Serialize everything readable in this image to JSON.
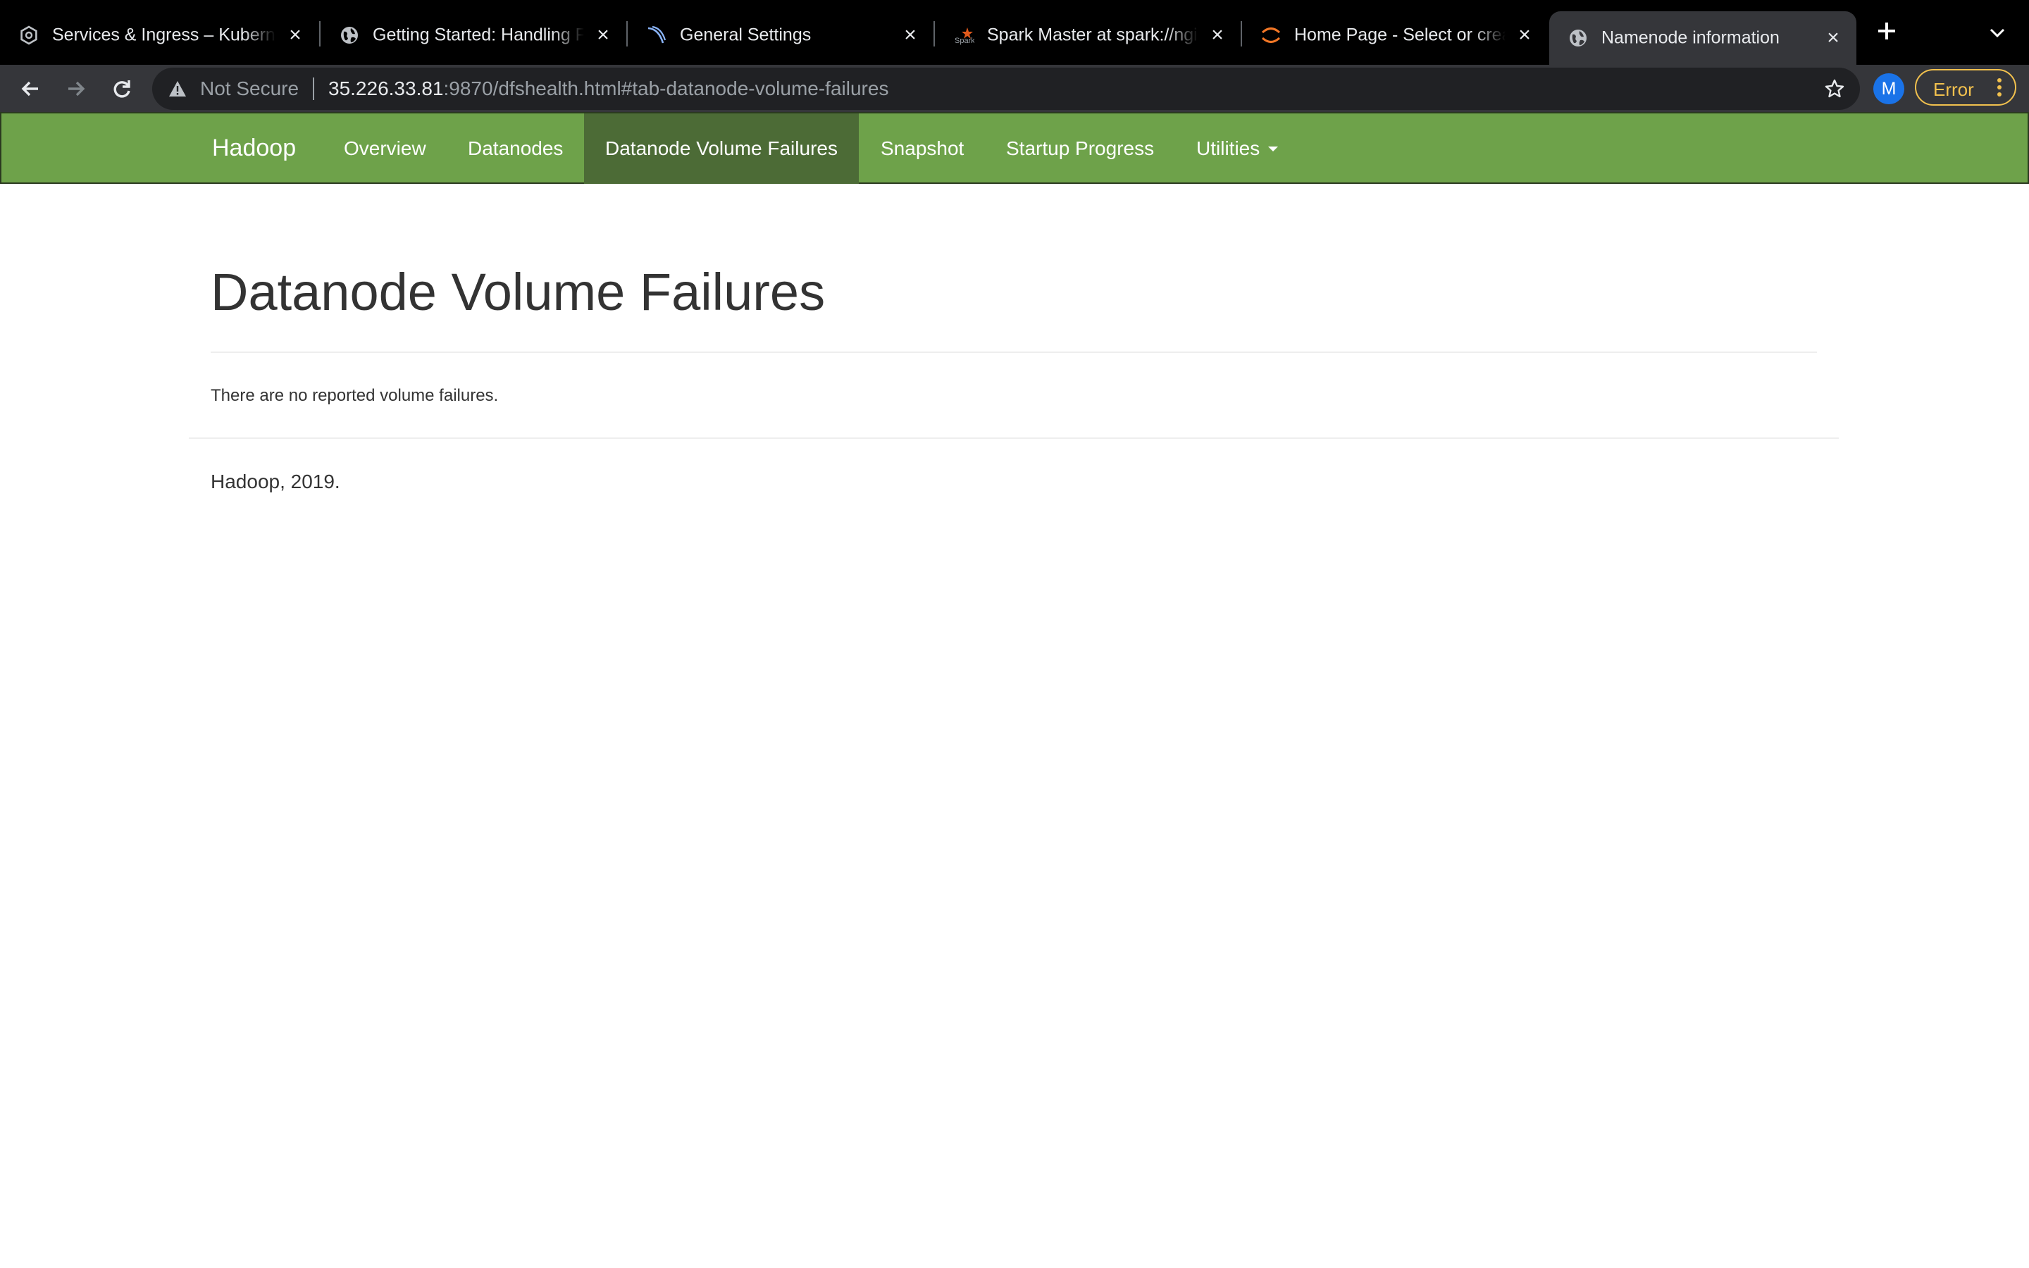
{
  "browser": {
    "tabs": [
      {
        "title": "Services & Ingress – Kubernetes Engine",
        "favicon": "kubernetes-engine-icon",
        "active": false
      },
      {
        "title": "Getting Started: Handling Forms",
        "favicon": "globe-icon",
        "active": false
      },
      {
        "title": "General Settings",
        "favicon": "wordpress-swoosh-icon",
        "active": false
      },
      {
        "title": "Spark Master at spark://nginx",
        "favicon": "spark-logo-icon",
        "active": false
      },
      {
        "title": "Home Page - Select or create a notebook",
        "favicon": "jupyter-icon",
        "active": false
      },
      {
        "title": "Namenode information",
        "favicon": "globe-icon",
        "active": true
      }
    ],
    "omnibox": {
      "security_label": "Not Secure",
      "url_host": "35.226.33.81",
      "url_rest": ":9870/dfshealth.html#tab-datanode-volume-failures"
    },
    "profile_initial": "M",
    "error_label": "Error",
    "colors": {
      "error": "#f2c14e",
      "avatar": "#1a73e8"
    }
  },
  "navbar": {
    "brand": "Hadoop",
    "items": [
      {
        "label": "Overview",
        "active": false
      },
      {
        "label": "Datanodes",
        "active": false
      },
      {
        "label": "Datanode Volume Failures",
        "active": true
      },
      {
        "label": "Snapshot",
        "active": false
      },
      {
        "label": "Startup Progress",
        "active": false
      },
      {
        "label": "Utilities",
        "active": false,
        "dropdown": true
      }
    ],
    "colors": {
      "background": "#6ea24a",
      "active": "#4c6b36"
    }
  },
  "main": {
    "title": "Datanode Volume Failures",
    "message": "There are no reported volume failures.",
    "footer": "Hadoop, 2019."
  }
}
